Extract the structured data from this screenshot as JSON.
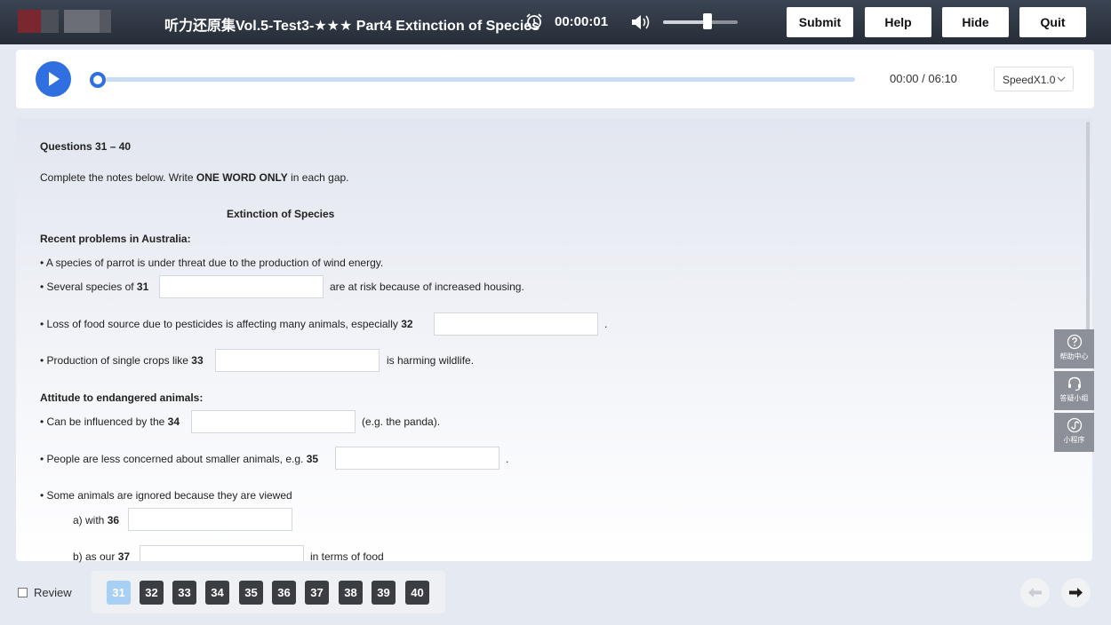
{
  "header": {
    "title": "听力还原集Vol.5-Test3-★★★ Part4 Extinction of Species",
    "timer": "00:00:01",
    "volume": 0.6,
    "buttons": {
      "submit": "Submit",
      "help": "Help",
      "hide": "Hide",
      "quit": "Quit"
    }
  },
  "audio": {
    "time": "00:00 / 06:10",
    "progress": 0,
    "speed": "SpeedX1.0"
  },
  "content": {
    "heading": "Questions 31 – 40",
    "instruction_pre": "Complete the notes below. Write ",
    "instruction_bold": "ONE WORD ONLY",
    "instruction_post": " in each gap.",
    "notes_title": "Extinction of Species",
    "section1": "Recent problems in Australia:",
    "line_parrot": "• A species of parrot is under threat due to the production of wind energy.",
    "q31_pre": "• Several species of ",
    "q31_num": "31",
    "q31_post": "are at risk because of increased housing.",
    "q32_pre": "• Loss of food source due to pesticides is affecting many animals, especially ",
    "q32_num": "32",
    "q32_post": ".",
    "q33_pre": "• Production of single crops like ",
    "q33_num": "33",
    "q33_post": "is harming wildlife.",
    "section2": "Attitude to endangered animals:",
    "q34_pre": "• Can be influenced by the ",
    "q34_num": "34",
    "q34_post": "(e.g. the panda).",
    "q35_pre": "• People are less concerned about smaller animals, e.g. ",
    "q35_num": "35",
    "q35_post": ".",
    "line_ignored": "• Some animals are ignored because they are viewed",
    "q36_pre": "a) with ",
    "q36_num": "36",
    "q37_pre": "b) as our ",
    "q37_num": "37",
    "q37_post": "in terms of food"
  },
  "side_widgets": [
    "帮助中心",
    "答疑小组",
    "小程序"
  ],
  "footer": {
    "review_label": "Review",
    "questions": [
      "31",
      "32",
      "33",
      "34",
      "35",
      "36",
      "37",
      "38",
      "39",
      "40"
    ],
    "active": "31"
  }
}
